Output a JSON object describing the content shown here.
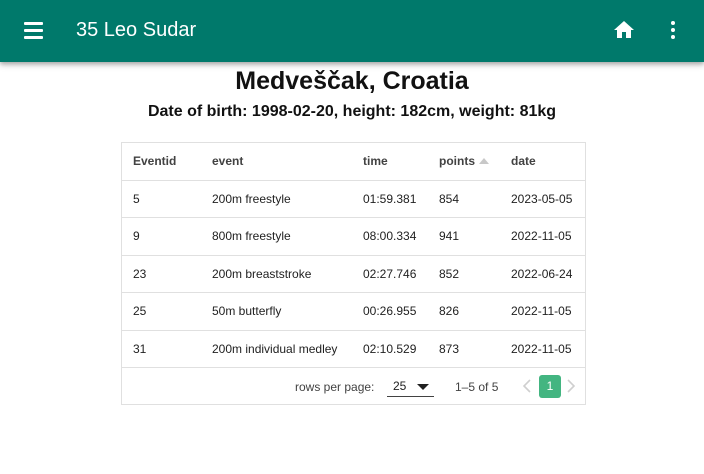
{
  "appbar": {
    "title": "35 Leo Sudar",
    "menu_icon": "menu-icon",
    "home_icon": "home-icon",
    "more_icon": "more-vert-icon",
    "color": "#00796b"
  },
  "athlete": {
    "club": "Medveščak, Croatia",
    "details": "Date of birth: 1998-02-20, height: 182cm, weight: 81kg"
  },
  "table": {
    "columns": [
      "Eventid",
      "event",
      "time",
      "points",
      "date"
    ],
    "sorted_column": "points",
    "rows": [
      [
        "5",
        "200m freestyle",
        "01:59.381",
        "854",
        "2023-05-05"
      ],
      [
        "9",
        "800m freestyle",
        "08:00.334",
        "941",
        "2022-11-05"
      ],
      [
        "23",
        "200m breaststroke",
        "02:27.746",
        "852",
        "2022-06-24"
      ],
      [
        "25",
        "50m butterfly",
        "00:26.955",
        "826",
        "2022-11-05"
      ],
      [
        "31",
        "200m individual medley",
        "02:10.529",
        "873",
        "2022-11-05"
      ]
    ]
  },
  "pagination": {
    "rows_per_page_label": "rows per page:",
    "rows_per_page_value": "25",
    "range": "1–5 of 5",
    "current_page": "1",
    "accent": "#43b581"
  }
}
